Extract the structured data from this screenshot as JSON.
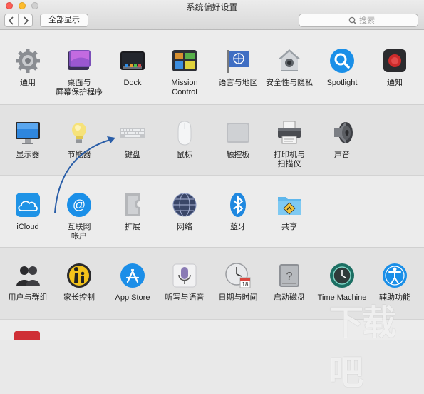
{
  "window": {
    "title": "系统偏好设置"
  },
  "toolbar": {
    "show_all": "全部显示"
  },
  "search": {
    "placeholder": "搜索"
  },
  "sections": [
    {
      "panes": [
        {
          "label": "通用",
          "icon": "gear-icon"
        },
        {
          "label": "桌面与\n屏幕保护程序",
          "icon": "desktop-screensaver-icon"
        },
        {
          "label": "Dock",
          "icon": "dock-icon"
        },
        {
          "label": "Mission\nControl",
          "icon": "mission-control-icon"
        },
        {
          "label": "语言与地区",
          "icon": "language-region-flag-icon"
        },
        {
          "label": "安全性与隐私",
          "icon": "security-house-icon"
        },
        {
          "label": "Spotlight",
          "icon": "spotlight-magnifier-icon"
        },
        {
          "label": "通知",
          "icon": "notifications-icon"
        }
      ]
    },
    {
      "panes": [
        {
          "label": "显示器",
          "icon": "display-monitor-icon"
        },
        {
          "label": "节能器",
          "icon": "energy-saver-bulb-icon"
        },
        {
          "label": "键盘",
          "icon": "keyboard-icon"
        },
        {
          "label": "鼠标",
          "icon": "mouse-icon"
        },
        {
          "label": "触控板",
          "icon": "trackpad-icon"
        },
        {
          "label": "打印机与\n扫描仪",
          "icon": "printer-icon"
        },
        {
          "label": "声音",
          "icon": "speaker-icon"
        }
      ]
    },
    {
      "panes": [
        {
          "label": "iCloud",
          "icon": "icloud-icon"
        },
        {
          "label": "互联网\n帐户",
          "icon": "internet-accounts-at-icon"
        },
        {
          "label": "扩展",
          "icon": "extensions-puzzle-icon"
        },
        {
          "label": "网络",
          "icon": "network-globe-icon"
        },
        {
          "label": "蓝牙",
          "icon": "bluetooth-icon"
        },
        {
          "label": "共享",
          "icon": "sharing-folder-icon"
        }
      ]
    },
    {
      "panes": [
        {
          "label": "用户与群组",
          "icon": "users-groups-icon"
        },
        {
          "label": "家长控制",
          "icon": "parental-controls-icon"
        },
        {
          "label": "App Store",
          "icon": "app-store-icon"
        },
        {
          "label": "听写与语音",
          "icon": "dictation-microphone-icon"
        },
        {
          "label": "日期与时间",
          "icon": "date-time-clock-icon"
        },
        {
          "label": "启动磁盘",
          "icon": "startup-disk-icon"
        },
        {
          "label": "Time Machine",
          "icon": "time-machine-icon"
        },
        {
          "label": "辅助功能",
          "icon": "accessibility-icon"
        }
      ]
    }
  ],
  "watermark": {
    "text": "下载吧"
  },
  "colors": {
    "annotation_arrow": "#2a5ea8",
    "notification_red": "#cc2b2b",
    "brand_blue": "#1a8fe8"
  }
}
